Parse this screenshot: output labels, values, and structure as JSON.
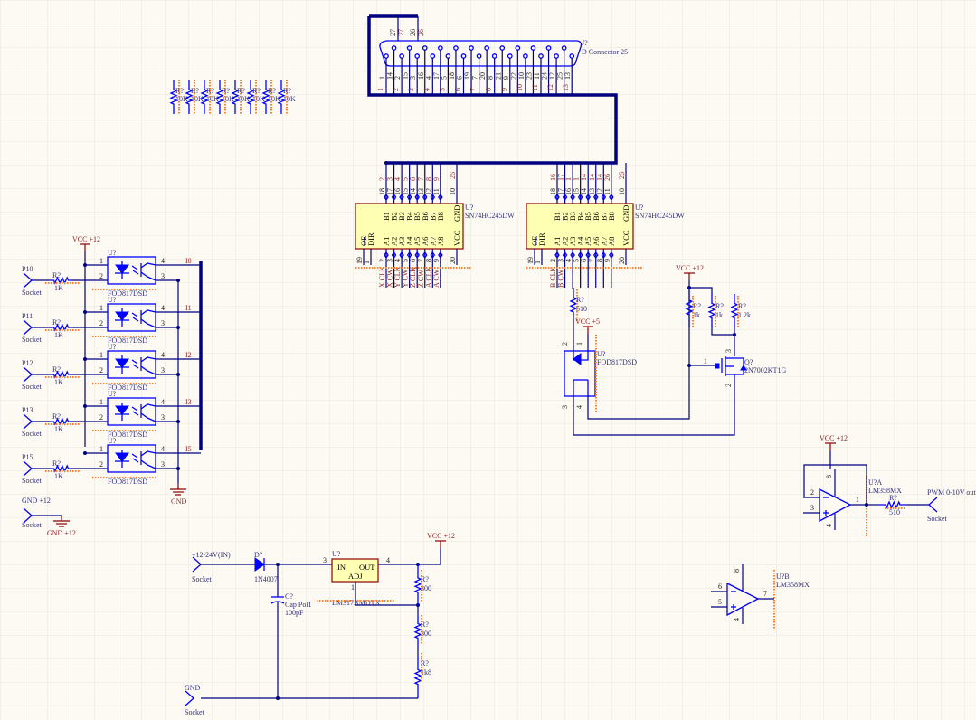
{
  "power": {
    "vcc12": "VCC +12",
    "vcc5": "VCC +5",
    "gnd": "GND",
    "gnd12": "GND +12"
  },
  "pullups": [
    {
      "ref": "R?",
      "value": "10K"
    },
    {
      "ref": "R?",
      "value": "10K"
    },
    {
      "ref": "R?",
      "value": "10K"
    },
    {
      "ref": "R?",
      "value": "10K"
    },
    {
      "ref": "R?",
      "value": "10K"
    },
    {
      "ref": "R?",
      "value": "10K"
    },
    {
      "ref": "R?",
      "value": "10K"
    },
    {
      "ref": "R?",
      "value": "10K"
    }
  ],
  "connector": {
    "ref": "J?",
    "name": "D Connector 25",
    "pins": [
      "1",
      "14",
      "2",
      "15",
      "3",
      "16",
      "4",
      "17",
      "5",
      "18",
      "6",
      "19",
      "7",
      "20",
      "8",
      "21",
      "9",
      "22",
      "10",
      "23",
      "11",
      "24",
      "12",
      "25",
      "13"
    ],
    "nets": [
      "1",
      "2",
      "3",
      "4",
      "5",
      "6",
      "7",
      "8",
      "9",
      "10",
      "11",
      "12",
      "13"
    ],
    "extra": [
      {
        "pin": "27",
        "net": "27"
      },
      {
        "pin": "26",
        "net": "26"
      }
    ]
  },
  "buffers": [
    {
      "ref": "U?",
      "part": "SN74HC245DW",
      "b_labels": [
        "B1",
        "B2",
        "B3",
        "B4",
        "B5",
        "B6",
        "B7",
        "B8"
      ],
      "a_labels": [
        "A1",
        "A2",
        "A3",
        "A4",
        "A5",
        "A6",
        "A7",
        "A8"
      ],
      "b_pin_nums": [
        "18",
        "17",
        "16",
        "15",
        "14",
        "13",
        "12",
        "11"
      ],
      "a_pin_nums": [
        "2",
        "3",
        "4",
        "5",
        "6",
        "7",
        "8",
        "9"
      ],
      "b_nets": [
        "2",
        "3",
        "4",
        "5",
        "6",
        "7",
        "8",
        "9"
      ],
      "a_nets": [
        "X CLK",
        "X CW",
        "Y CLK",
        "Y CW",
        "Z CLK",
        "Z CW",
        "A CLK",
        "A CW"
      ],
      "oe": "OE",
      "dir": "DIR",
      "oe_pin": "19",
      "dir_pin": "1",
      "vcc": "VCC",
      "gnd": "GND",
      "vcc_pin": "20",
      "gnd_pin": "10",
      "gnd_net": "26"
    },
    {
      "ref": "U?",
      "part": "SN74HC245DW",
      "b_labels": [
        "B1",
        "B2",
        "B3",
        "B4",
        "B5",
        "B6",
        "B7",
        "B8"
      ],
      "a_labels": [
        "A1",
        "A2",
        "A3",
        "A4",
        "A5",
        "A6",
        "A7",
        "A8"
      ],
      "b_pin_nums": [
        "18",
        "17",
        "16",
        "15",
        "14",
        "13",
        "12",
        "11"
      ],
      "a_pin_nums": [
        "2",
        "3",
        "4",
        "5",
        "6",
        "7",
        "8",
        "9"
      ],
      "b_nets": [
        "16",
        "17",
        "1",
        "1",
        "14",
        "14",
        "14",
        "26"
      ],
      "a_nets": [
        "B CLK",
        "B CW",
        "",
        "",
        "",
        "",
        "",
        ""
      ],
      "oe": "OE",
      "dir": "DIR",
      "oe_pin": "19",
      "dir_pin": "1",
      "vcc": "VCC",
      "gnd": "GND",
      "vcc_pin": "20",
      "gnd_pin": "10",
      "gnd_net": "26"
    }
  ],
  "opto_pins": [
    "1",
    "2",
    "3",
    "4"
  ],
  "optos": [
    {
      "socket": "P10",
      "socket_type": "Socket",
      "r_ref": "R?",
      "r_value": "1K",
      "u_ref": "U?",
      "part": "FOD817DSD",
      "net": "I0"
    },
    {
      "socket": "P11",
      "socket_type": "Socket",
      "r_ref": "R?",
      "r_value": "1K",
      "u_ref": "U?",
      "part": "FOD817DSD",
      "net": "I1"
    },
    {
      "socket": "P12",
      "socket_type": "Socket",
      "r_ref": "R?",
      "r_value": "1K",
      "u_ref": "U?",
      "part": "FOD817DSD",
      "net": "I2"
    },
    {
      "socket": "P13",
      "socket_type": "Socket",
      "r_ref": "R?",
      "r_value": "1K",
      "u_ref": "U?",
      "part": "FOD817DSD",
      "net": "I3"
    },
    {
      "socket": "P15",
      "socket_type": "Socket",
      "r_ref": "R?",
      "r_value": "1K",
      "u_ref": "U?",
      "part": "FOD817DSD",
      "net": "I5"
    }
  ],
  "gnd_socket": {
    "label": "GND +12",
    "type": "Socket"
  },
  "regulator_section": {
    "in_socket": {
      "label": "+12-24V(IN)",
      "type": "Socket"
    },
    "gnd_socket": {
      "label": "GND",
      "type": "Socket"
    },
    "diode": {
      "ref": "D?",
      "part": "1N4007"
    },
    "cap": {
      "ref": "C?",
      "part": "Cap Pol1",
      "value": "100pF"
    },
    "reg": {
      "ref": "U?",
      "part": "LM317AMDTX",
      "in": "IN",
      "out": "OUT",
      "adj": "ADJ",
      "in_pin": "3",
      "out_pin": "4",
      "adj_pin": "1"
    },
    "resistors": [
      {
        "ref": "R?",
        "value": "300"
      },
      {
        "ref": "R?",
        "value": "300"
      },
      {
        "ref": "R?",
        "value": "1k8"
      }
    ]
  },
  "isolator": {
    "r_series": {
      "ref": "R?",
      "value": "510"
    },
    "opto": {
      "ref": "U?",
      "part": "FOD817DSD",
      "pins": [
        "2",
        "1",
        "3",
        "4"
      ]
    },
    "r_pull": [
      {
        "ref": "R?",
        "value": "1k"
      },
      {
        "ref": "R?",
        "value": "1k"
      },
      {
        "ref": "R?",
        "value": "1.2k"
      }
    ],
    "mosfet": {
      "ref": "Q?",
      "part": "2N7002KT1G",
      "gate": "1",
      "drain": "3",
      "source": "2"
    }
  },
  "opamp": {
    "a": {
      "ref": "U?A",
      "part": "LM358MX",
      "inv": "2",
      "noninv": "3",
      "out": "1",
      "vpos": "8",
      "vneg": "4"
    },
    "b": {
      "ref": "U?B",
      "part": "LM358MX",
      "inv": "6",
      "noninv": "5",
      "out": "7",
      "vpos": "8",
      "vneg": "4"
    },
    "r_out": {
      "ref": "R?",
      "value": "510"
    },
    "out_socket": {
      "label": "PWM 0-10V out",
      "type": "Socket"
    }
  }
}
